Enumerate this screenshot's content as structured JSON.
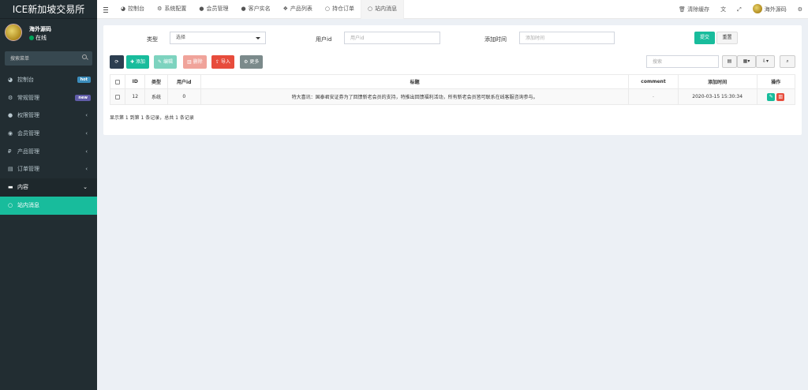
{
  "app": {
    "title": "ICE新加坡交易所"
  },
  "user": {
    "name": "海外源码",
    "status": "在线"
  },
  "sidebar": {
    "search_placeholder": "搜索菜单",
    "items": [
      {
        "label": "控制台",
        "icon": "dashboard-icon",
        "badge": "hot",
        "badge_color": "#3c8dbc"
      },
      {
        "label": "常规管理",
        "icon": "cogs-icon",
        "badge": "new",
        "badge_color": "#605ca8"
      },
      {
        "label": "权限管理",
        "icon": "users-icon",
        "chevron": "‹"
      },
      {
        "label": "会员管理",
        "icon": "user-circle-icon",
        "chevron": "‹"
      },
      {
        "label": "产品管理",
        "icon": "product-icon",
        "chevron": "‹"
      },
      {
        "label": "订单管理",
        "icon": "list-icon",
        "chevron": "‹"
      },
      {
        "label": "内容",
        "icon": "content-icon",
        "chevron": "⌄"
      },
      {
        "label": "站内消息",
        "icon": "circle-icon"
      }
    ]
  },
  "tabs": [
    {
      "label": "控制台",
      "icon": "dashboard-icon"
    },
    {
      "label": "系统配置",
      "icon": "cog-icon"
    },
    {
      "label": "会员管理",
      "icon": "user-icon"
    },
    {
      "label": "客户实名",
      "icon": "user-icon"
    },
    {
      "label": "产品列表",
      "icon": "cubes-icon"
    },
    {
      "label": "持仓订单",
      "icon": "circle-icon"
    },
    {
      "label": "站内消息",
      "icon": "circle-icon"
    }
  ],
  "topbar": {
    "clear_cache": "清除缓存",
    "user_name": "海外源码"
  },
  "filters": {
    "type_label": "类型",
    "type_value": "选择",
    "userid_label": "用户id",
    "userid_placeholder": "用户id",
    "time_label": "添加时间",
    "time_placeholder": "添加时间",
    "submit": "提交",
    "reset": "重置"
  },
  "toolbar": {
    "add": "添加",
    "edit": "编辑",
    "delete": "删除",
    "import": "导入",
    "more": "更多",
    "search_placeholder": "搜索"
  },
  "table": {
    "headers": [
      "ID",
      "类型",
      "用户id",
      "标题",
      "comment",
      "添加时间",
      "操作"
    ],
    "rows": [
      {
        "id": "12",
        "type": "系统",
        "user_id": "0",
        "title": "特大喜讯：国泰君安证券为了回馈新老会员的支持，特推出回馈福利活动，所有新老会员皆可联系在线客服咨询参与。",
        "comment": "-",
        "time": "2020-03-15 15:30:34"
      }
    ]
  },
  "summary": "显示第 1 到第 1 条记录，总共 1 条记录"
}
